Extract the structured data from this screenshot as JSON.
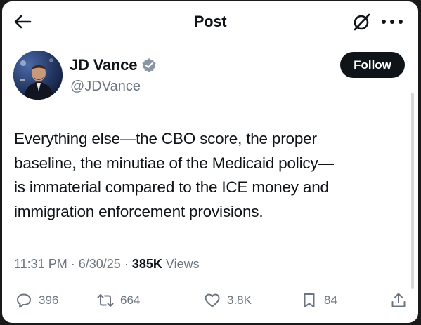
{
  "header": {
    "title": "Post",
    "back_icon": "arrow-left-icon",
    "grok_icon": "grok-icon",
    "more_icon": "more-horizontal-icon"
  },
  "author": {
    "name": "JD Vance",
    "handle": "@JDVance",
    "verified_icon": "verified-badge-icon",
    "follow_label": "Follow"
  },
  "post": {
    "lines": [
      "Everything else—the CBO score, the proper",
      "baseline, the minutiae of the Medicaid policy—",
      "is immaterial compared to the ICE money and",
      "immigration enforcement provisions."
    ],
    "time": "11:31 PM",
    "date": "6/30/25",
    "separator": "·",
    "views_count": "385K",
    "views_label": "Views"
  },
  "actions": {
    "replies": "396",
    "reposts": "664",
    "likes": "3.8K",
    "bookmarks": "84"
  },
  "colors": {
    "text_primary": "#0f1419",
    "text_secondary": "#6b7580",
    "verified": "#8a96a3",
    "follow_bg": "#0f1419"
  }
}
